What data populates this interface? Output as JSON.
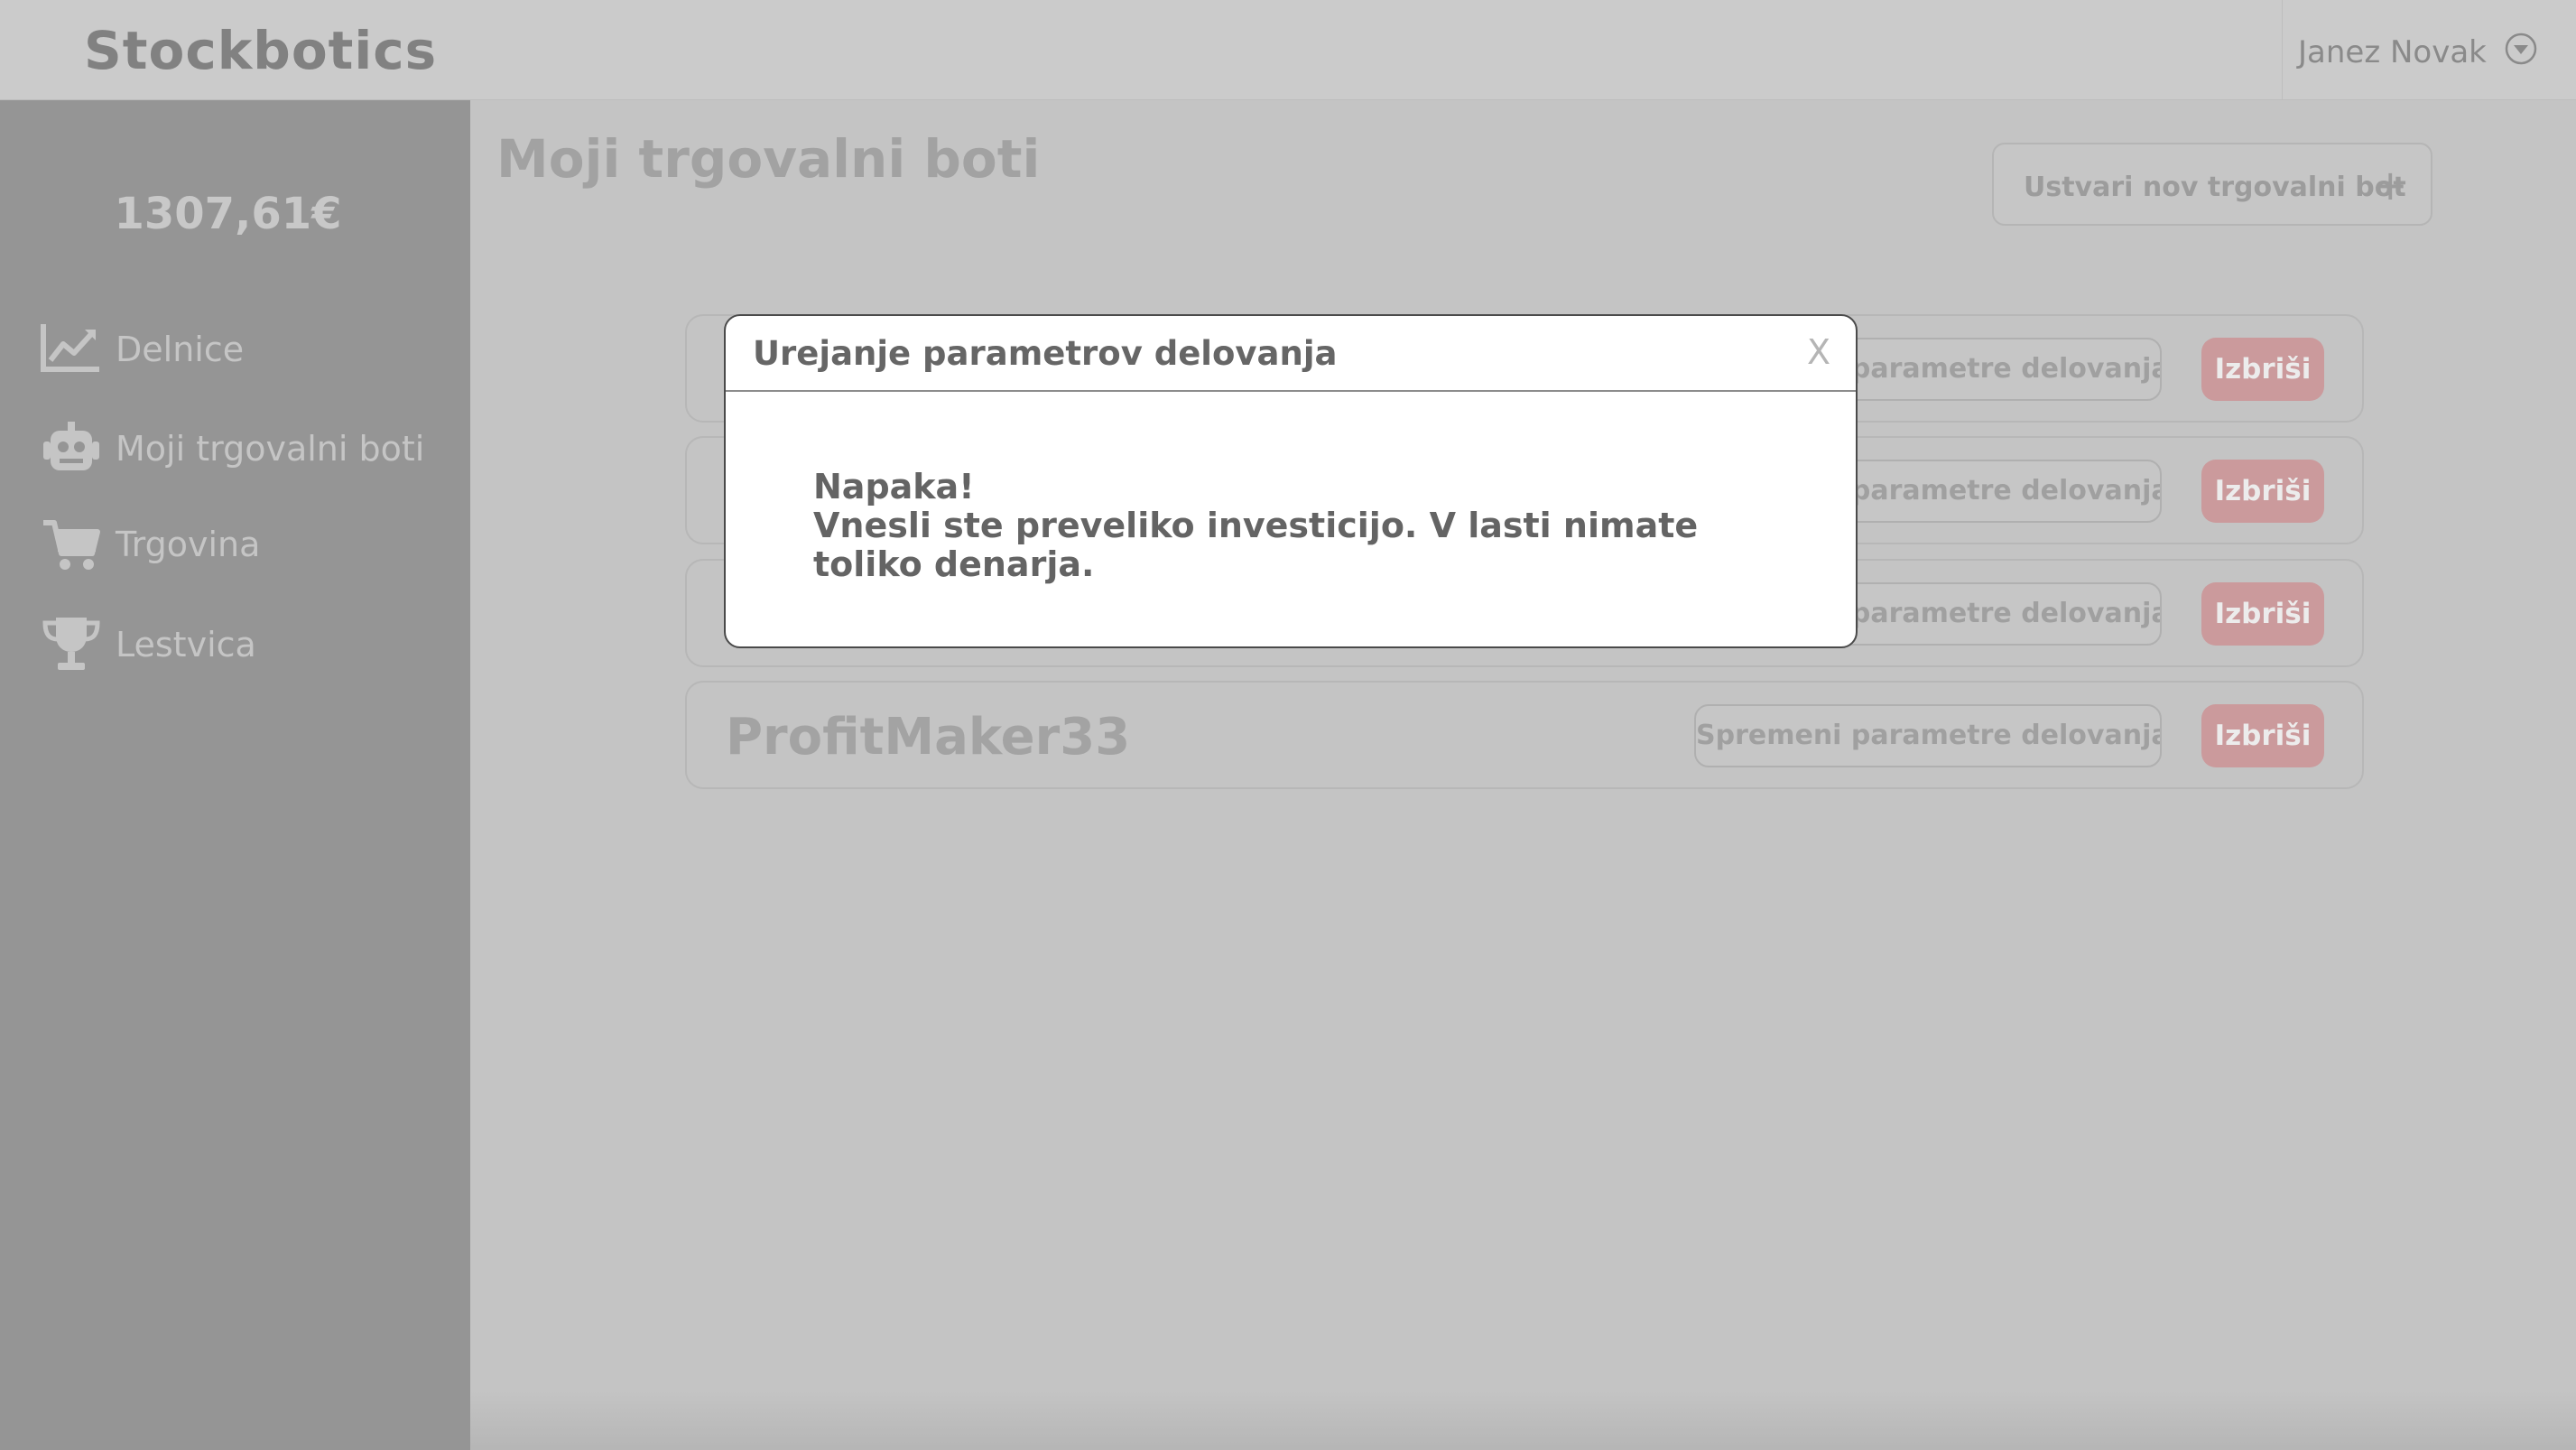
{
  "header": {
    "app_title": "Stockbotics",
    "user_name": "Janez Novak",
    "user_menu_icon": "chevron-down-circle-icon"
  },
  "sidebar": {
    "balance": "1307,61€",
    "items": [
      {
        "label": "Delnice",
        "icon": "chart-line-icon"
      },
      {
        "label": "Moji trgovalni boti",
        "icon": "robot-icon"
      },
      {
        "label": "Trgovina",
        "icon": "cart-icon"
      },
      {
        "label": "Lestvica",
        "icon": "trophy-icon"
      }
    ]
  },
  "main": {
    "title": "Moji trgovalni boti",
    "create_button": "Ustvari nov trgovalni bot",
    "create_icon": "+",
    "bots": [
      {
        "name": "",
        "edit_label": "Spremeni parametre delovanja",
        "delete_label": "Izbriši"
      },
      {
        "name": "",
        "edit_label": "Spremeni parametre delovanja",
        "delete_label": "Izbriši"
      },
      {
        "name": "",
        "edit_label": "Spremeni parametre delovanja",
        "delete_label": "Izbriši"
      },
      {
        "name": "ProfitMaker33",
        "edit_label": "Spremeni parametre delovanja",
        "delete_label": "Izbriši"
      }
    ]
  },
  "modal": {
    "title": "Urejanje parametrov delovanja",
    "close_label": "X",
    "error_title": "Napaka!",
    "error_message": "Vnesli ste preveliko investicijo. V lasti nimate toliko denarja."
  },
  "colors": {
    "header_bg": "#cbcbcb",
    "sidebar_bg": "#959595",
    "content_bg": "#c4c4c4",
    "delete_button": "#cb9a9c",
    "modal_bg": "#ffffff"
  }
}
